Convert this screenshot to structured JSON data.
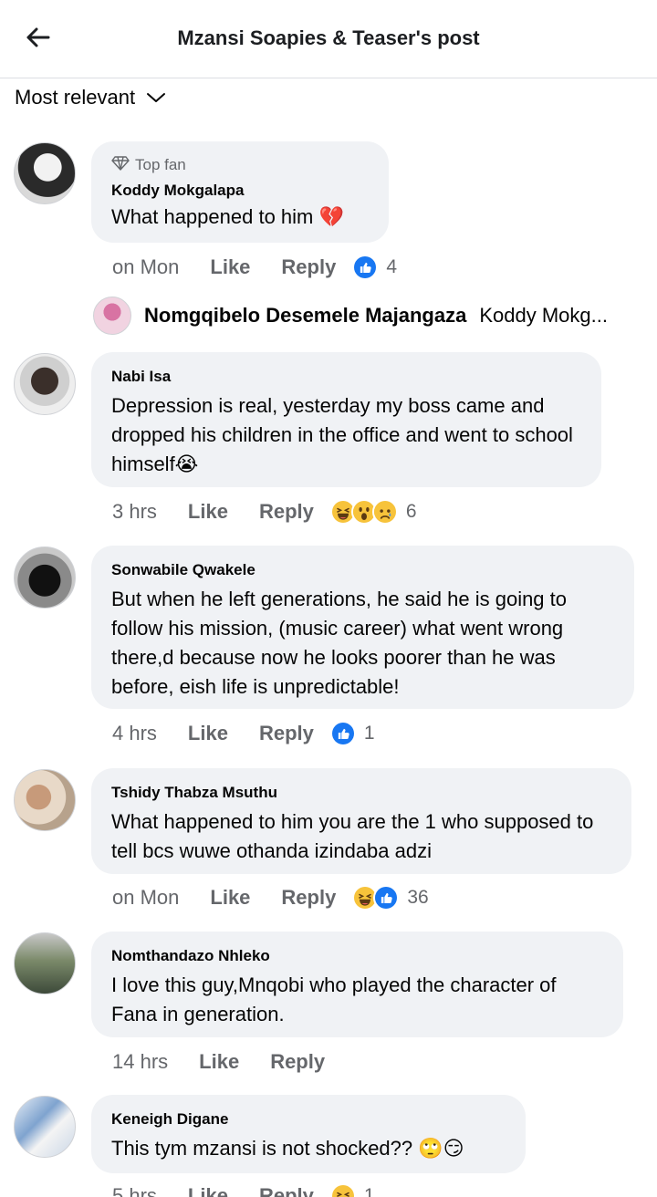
{
  "header": {
    "title": "Mzansi Soapies & Teaser's post"
  },
  "sort": {
    "label": "Most relevant"
  },
  "comments": [
    {
      "badge": "Top fan",
      "author": "Koddy Mokgalapa",
      "text": "What happened to him 💔",
      "time": "on Mon",
      "like": "Like",
      "reply": "Reply",
      "reactions": [
        "like"
      ],
      "count": "4"
    },
    {
      "author": "Nabi Isa",
      "text": "Depression is real, yesterday my boss came and dropped his children in the office and went to school himself😭",
      "time": "3 hrs",
      "like": "Like",
      "reply": "Reply",
      "reactions": [
        "haha",
        "wow",
        "sad"
      ],
      "count": "6"
    },
    {
      "author": "Sonwabile Qwakele",
      "text": "But when he left generations, he said he is going to follow his mission, (music career) what went wrong there,d because now he looks poorer than he was before, eish life is unpredictable!",
      "time": "4 hrs",
      "like": "Like",
      "reply": "Reply",
      "reactions": [
        "like"
      ],
      "count": "1"
    },
    {
      "author": "Tshidy Thabza Msuthu",
      "text": "What happened to him you are the 1 who supposed to tell bcs wuwe othanda izindaba adzi",
      "time": "on Mon",
      "like": "Like",
      "reply": "Reply",
      "reactions": [
        "haha",
        "like"
      ],
      "count": "36"
    },
    {
      "author": "Nomthandazo Nhleko",
      "text": "I love this guy,Mnqobi who played the character of Fana in generation.",
      "time": "14 hrs",
      "like": "Like",
      "reply": "Reply",
      "reactions": [],
      "count": ""
    },
    {
      "author": "Keneigh Digane",
      "text": "This tym mzansi is not shocked?? 🙄😏",
      "time": "5 hrs",
      "like": "Like",
      "reply": "Reply",
      "reactions": [
        "haha"
      ],
      "count": "1"
    }
  ],
  "reply_preview": {
    "name": "Nomgqibelo Desemele Majangaza",
    "snippet": "Koddy Mokg..."
  },
  "icons": {
    "back": "back-arrow-icon",
    "chevron": "chevron-down-icon",
    "badge": "diamond-icon",
    "like_reaction": "like-reaction-icon",
    "haha_reaction": "haha-reaction-icon",
    "wow_reaction": "wow-reaction-icon",
    "sad_reaction": "sad-reaction-icon"
  },
  "colors": {
    "bubble": "#f0f2f5",
    "secondary_text": "#65676b",
    "like_blue": "#1877f2",
    "emoji_yellow": "#f7c33b"
  }
}
